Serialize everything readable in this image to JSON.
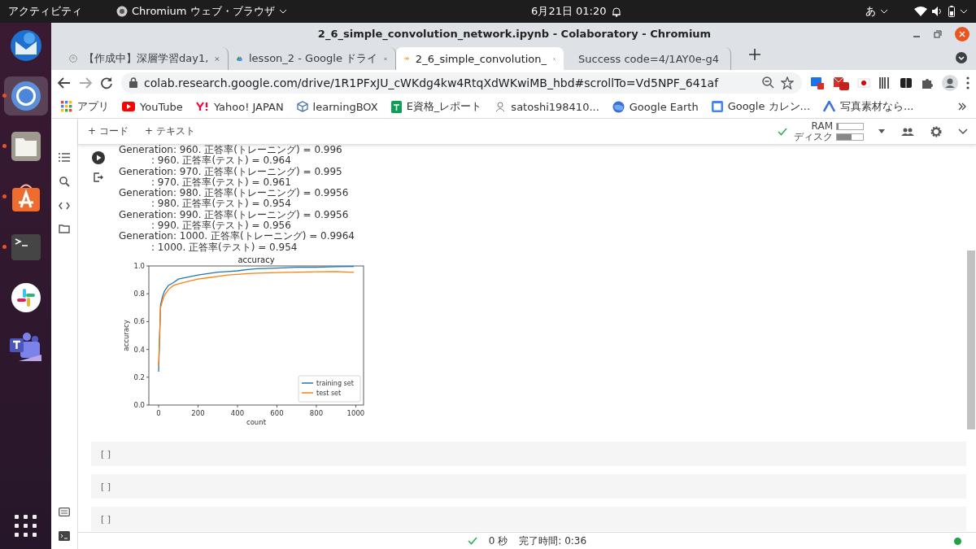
{
  "top_bar": {
    "activities": "アクティビティ",
    "app": "Chromium ウェブ・ブラウザ",
    "clock": "6月21日 01:20",
    "input_method": "あ"
  },
  "dock": [
    {
      "kind": "mail",
      "running": false,
      "selected": false
    },
    {
      "kind": "browser",
      "running": true,
      "selected": true
    },
    {
      "kind": "files",
      "running": true,
      "selected": false
    },
    {
      "kind": "store",
      "running": true,
      "selected": false
    },
    {
      "kind": "terminal",
      "running": true,
      "selected": false
    },
    {
      "kind": "chat",
      "running": false,
      "selected": false
    },
    {
      "kind": "teams",
      "running": false,
      "selected": false
    }
  ],
  "window": {
    "title": "2_6_simple_convolution_network.ipynb - Colaboratory - Chromium"
  },
  "tabs": [
    {
      "kind": "page",
      "label": "【作成中】深層学習day1,",
      "selected": false
    },
    {
      "kind": "drive",
      "label": "lesson_2 - Google ドライ",
      "selected": false
    },
    {
      "kind": "colab",
      "label": "2_6_simple_convolution_",
      "selected": true
    },
    {
      "kind": "google",
      "label": "Success code=4/1AY0e-g4",
      "selected": false
    }
  ],
  "address_bar": {
    "url": "colab.research.google.com/drive/1R1PFxJU_cWKdg4kw4RtqXdWKwiMB_hbd#scrollTo=Vd5NPF_641af"
  },
  "bookmarks": [
    {
      "kind": "apps",
      "label": "アプリ"
    },
    {
      "kind": "video",
      "label": "YouTube"
    },
    {
      "kind": "yahoo",
      "label": "Yahoo! JAPAN"
    },
    {
      "kind": "box",
      "label": "learningBOX"
    },
    {
      "kind": "sheet",
      "label": "E資格_レポート"
    },
    {
      "kind": "person",
      "label": "satoshi198410..."
    },
    {
      "kind": "globe",
      "label": "Google Earth"
    },
    {
      "kind": "calendar",
      "label": "Google カレン..."
    },
    {
      "kind": "photo",
      "label": "写真素材なら..."
    }
  ],
  "toolbar": {
    "add_code": "+ コード",
    "add_text": "+ テキスト",
    "ram_label": "RAM",
    "disk_label": "ディスク",
    "ram": {
      "level": 0.05
    },
    "disk": {
      "level": 0.55
    }
  },
  "output": {
    "lines": [
      {
        "kind": "train",
        "text": "Generation: 960. 正答率(トレーニング) = 0.996"
      },
      {
        "kind": "test",
        "text": ": 960. 正答率(テスト) = 0.964"
      },
      {
        "kind": "train",
        "text": "Generation: 970. 正答率(トレーニング) = 0.995"
      },
      {
        "kind": "test",
        "text": ": 970. 正答率(テスト) = 0.961"
      },
      {
        "kind": "train",
        "text": "Generation: 980. 正答率(トレーニング) = 0.9956"
      },
      {
        "kind": "test",
        "text": ": 980. 正答率(テスト) = 0.954"
      },
      {
        "kind": "train",
        "text": "Generation: 990. 正答率(トレーニング) = 0.9956"
      },
      {
        "kind": "test",
        "text": ": 990. 正答率(テスト) = 0.956"
      },
      {
        "kind": "train",
        "text": "Generation: 1000. 正答率(トレーニング) = 0.9964"
      },
      {
        "kind": "test",
        "text": ": 1000. 正答率(テスト) = 0.954"
      }
    ],
    "chart_data": {
      "type": "line",
      "title": "accuracy",
      "xlabel": "count",
      "ylabel": "accuracy",
      "x": [
        0,
        10,
        20,
        30,
        50,
        75,
        100,
        150,
        200,
        250,
        300,
        350,
        400,
        450,
        500,
        600,
        700,
        800,
        900,
        990
      ],
      "series": [
        {
          "name": "training set",
          "color": "#1f77b4",
          "values": [
            0.24,
            0.72,
            0.78,
            0.82,
            0.86,
            0.88,
            0.905,
            0.92,
            0.935,
            0.945,
            0.955,
            0.96,
            0.965,
            0.975,
            0.98,
            0.985,
            0.99,
            0.99,
            0.995,
            0.996
          ]
        },
        {
          "name": "test set",
          "color": "#ff7f0e",
          "values": [
            0.28,
            0.7,
            0.75,
            0.79,
            0.83,
            0.86,
            0.87,
            0.89,
            0.905,
            0.915,
            0.925,
            0.935,
            0.94,
            0.945,
            0.948,
            0.952,
            0.955,
            0.958,
            0.96,
            0.954
          ]
        }
      ],
      "legend": "lower right",
      "xlim": [
        -49.5,
        1039.5
      ],
      "ylim": [
        0,
        1
      ],
      "xticks": [
        0,
        200,
        400,
        600,
        800,
        1000
      ],
      "yticks": [
        {
          "value": 0,
          "label": "0.0"
        },
        {
          "value": 0.2,
          "label": "0.2"
        },
        {
          "value": 0.4,
          "label": "0.4"
        },
        {
          "value": 0.6,
          "label": "0.6"
        },
        {
          "value": 0.8,
          "label": "0.8"
        },
        {
          "value": 1,
          "label": "1.0"
        }
      ]
    }
  },
  "cells": [
    {
      "prompt": "[ ]"
    },
    {
      "prompt": "[ ]"
    },
    {
      "prompt": "[ ]"
    }
  ],
  "status_bar": {
    "elapsed": "0 秒",
    "completed": "完了時間: 0:36"
  }
}
